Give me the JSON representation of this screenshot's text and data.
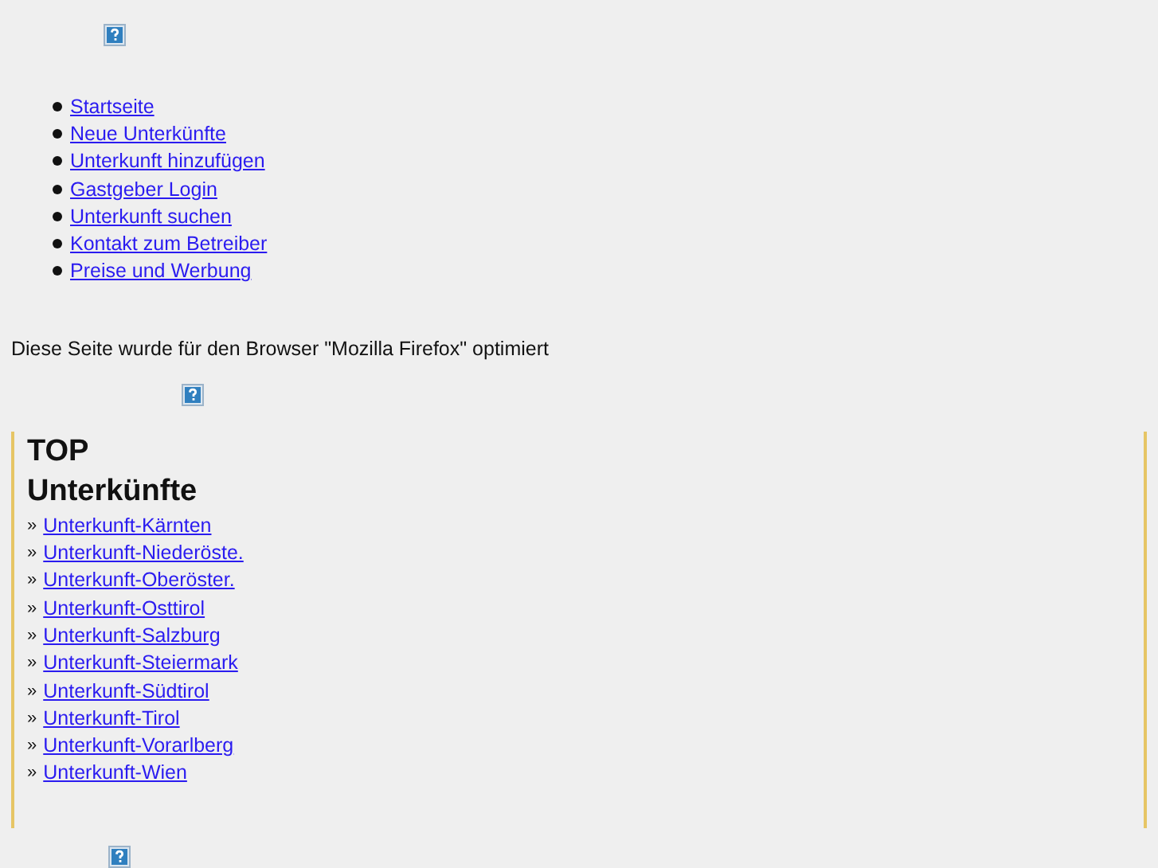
{
  "nav": [
    {
      "label": "Startseite"
    },
    {
      "label": "Neue Unterkünfte"
    },
    {
      "label": "Unterkunft hinzufügen"
    },
    {
      "label": "Gastgeber Login"
    },
    {
      "label": "Unterkunft suchen"
    },
    {
      "label": "Kontakt zum Betreiber"
    },
    {
      "label": "Preise und Werbung"
    }
  ],
  "notice": "Diese Seite wurde für den Browser \"Mozilla Firefox\" optimiert",
  "sidebar": {
    "heading": "TOP Unterkünfte",
    "links": [
      {
        "marker": "»",
        "label": "Unterkunft-Kärnten"
      },
      {
        "marker": "»",
        "label": "Unterkunft-Niederöste."
      },
      {
        "marker": "»",
        "label": "Unterkunft-Oberöster."
      },
      {
        "marker": "»",
        "label": "Unterkunft-Osttirol"
      },
      {
        "marker": "»",
        "label": "Unterkunft-Salzburg"
      },
      {
        "marker": "»",
        "label": "Unterkunft-Steiermark"
      },
      {
        "marker": "»",
        "label": "Unterkunft-Südtirol"
      },
      {
        "marker": "»",
        "label": "Unterkunft-Tirol"
      },
      {
        "marker": "»",
        "label": "Unterkunft-Vorarlberg"
      },
      {
        "marker": "»",
        "label": "Unterkunft-Wien"
      }
    ]
  }
}
